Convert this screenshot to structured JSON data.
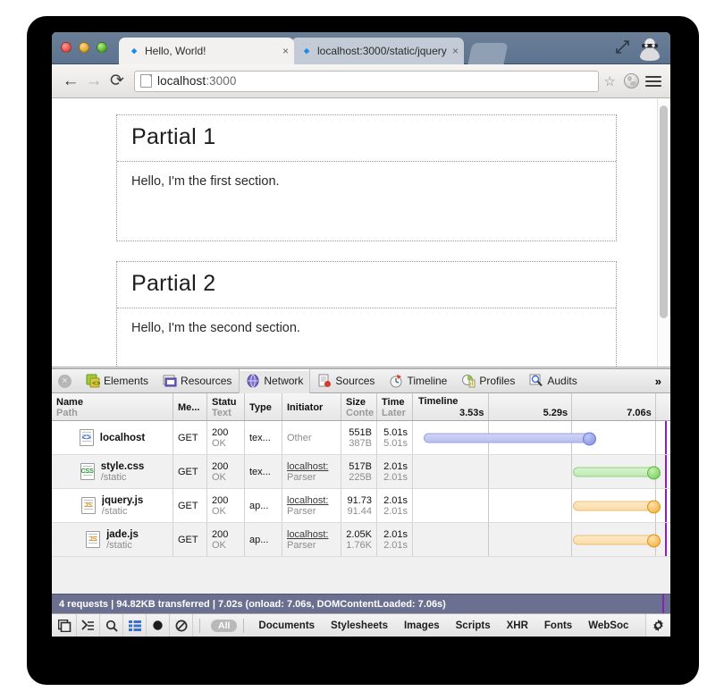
{
  "browser": {
    "window_controls": [
      "close",
      "minimize",
      "maximize"
    ],
    "tabs": [
      {
        "title": "Hello, World!",
        "favicon": "chrome-devtools-favicon",
        "close_label": "×",
        "active": true
      },
      {
        "title": "localhost:3000/static/jquery",
        "favicon": "chrome-devtools-favicon",
        "close_label": "×",
        "active": false
      }
    ],
    "toolbar": {
      "back_label": "←",
      "forward_label": "→",
      "reload_label": "⟳",
      "url_scheme": "localhost",
      "url_port": ":3000",
      "star_label": "☆"
    }
  },
  "page": {
    "partials": [
      {
        "heading": "Partial 1",
        "text": "Hello, I'm the first section."
      },
      {
        "heading": "Partial 2",
        "text": "Hello, I'm the second section."
      }
    ]
  },
  "devtools": {
    "close_label": "×",
    "panels": [
      {
        "label": "Elements",
        "icon": "elements-icon",
        "selected": false
      },
      {
        "label": "Resources",
        "icon": "resources-icon",
        "selected": false
      },
      {
        "label": "Network",
        "icon": "network-icon",
        "selected": true
      },
      {
        "label": "Sources",
        "icon": "sources-icon",
        "selected": false
      },
      {
        "label": "Timeline",
        "icon": "timeline-icon",
        "selected": false
      },
      {
        "label": "Profiles",
        "icon": "profiles-icon",
        "selected": false
      },
      {
        "label": "Audits",
        "icon": "audits-icon",
        "selected": false
      }
    ],
    "overflow_label": "»",
    "columns": {
      "name": {
        "main": "Name",
        "sub": "Path"
      },
      "method": {
        "main": "Me..."
      },
      "status": {
        "main": "Statu",
        "sub": "Text"
      },
      "type": {
        "main": "Type"
      },
      "initiator": {
        "main": "Initiator"
      },
      "size": {
        "main": "Size",
        "sub": "Contе"
      },
      "time": {
        "main": "Time",
        "sub": "Later"
      },
      "timeline": {
        "main": "Timeline"
      }
    },
    "timeline_ticks": [
      "3.53s",
      "5.29s",
      "7.06s"
    ],
    "requests": [
      {
        "name": "localhost",
        "path": "",
        "icon": "html-file-icon",
        "icon_glyph": "<>",
        "method": "GET",
        "status": "200",
        "status_text": "OK",
        "type": "tex...",
        "initiator": "Other",
        "initiator_sub": "",
        "initiator_is_link": false,
        "size": "551B",
        "size_content": "387B",
        "time": "5.01s",
        "latency": "5.01s",
        "bar_color": "blue",
        "bar_start_pct": 4,
        "bar_end_pct": 70
      },
      {
        "name": "style.css",
        "path": "/static",
        "icon": "css-file-icon",
        "icon_glyph": "CSS",
        "method": "GET",
        "status": "200",
        "status_text": "OK",
        "type": "tex...",
        "initiator": "localhost:",
        "initiator_sub": "Parser",
        "initiator_is_link": true,
        "size": "517B",
        "size_content": "225B",
        "time": "2.01s",
        "latency": "2.01s",
        "bar_color": "green",
        "bar_start_pct": 62,
        "bar_end_pct": 95
      },
      {
        "name": "jquery.js",
        "path": "/static",
        "icon": "js-file-icon",
        "icon_glyph": "JS",
        "method": "GET",
        "status": "200",
        "status_text": "OK",
        "type": "ap...",
        "initiator": "localhost:",
        "initiator_sub": "Parser",
        "initiator_is_link": true,
        "size": "91.73",
        "size_content": "91.44",
        "time": "2.01s",
        "latency": "2.01s",
        "bar_color": "orange",
        "bar_start_pct": 62,
        "bar_end_pct": 95
      },
      {
        "name": "jade.js",
        "path": "/static",
        "icon": "js-file-icon",
        "icon_glyph": "JS",
        "method": "GET",
        "status": "200",
        "status_text": "OK",
        "type": "ap...",
        "initiator": "localhost:",
        "initiator_sub": "Parser",
        "initiator_is_link": true,
        "size": "2.05K",
        "size_content": "1.76K",
        "time": "2.01s",
        "latency": "2.01s",
        "bar_color": "orange",
        "bar_start_pct": 62,
        "bar_end_pct": 95
      }
    ],
    "summary": "4 requests  |  94.82KB transferred  |  7.02s (onload: 7.06s, DOMContentLoaded: 7.06s)",
    "filter_buttons": [
      {
        "icon": "dock-icon"
      },
      {
        "icon": "console-icon"
      },
      {
        "icon": "search-icon"
      },
      {
        "icon": "list-view-icon"
      },
      {
        "icon": "record-icon"
      },
      {
        "icon": "clear-icon"
      }
    ],
    "filter_all": "All",
    "filter_types": [
      "Documents",
      "Stylesheets",
      "Images",
      "Scripts",
      "XHR",
      "Fonts",
      "WebSoc"
    ],
    "settings_icon": "gear-icon"
  },
  "colors": {
    "titlebar": "#5c7390",
    "summary_bg": "#6b7090",
    "event_line": "#8a1fbe",
    "bar_blue": "#b9c0ef",
    "bar_green": "#bfe9b2",
    "bar_orange": "#fbdca6"
  }
}
